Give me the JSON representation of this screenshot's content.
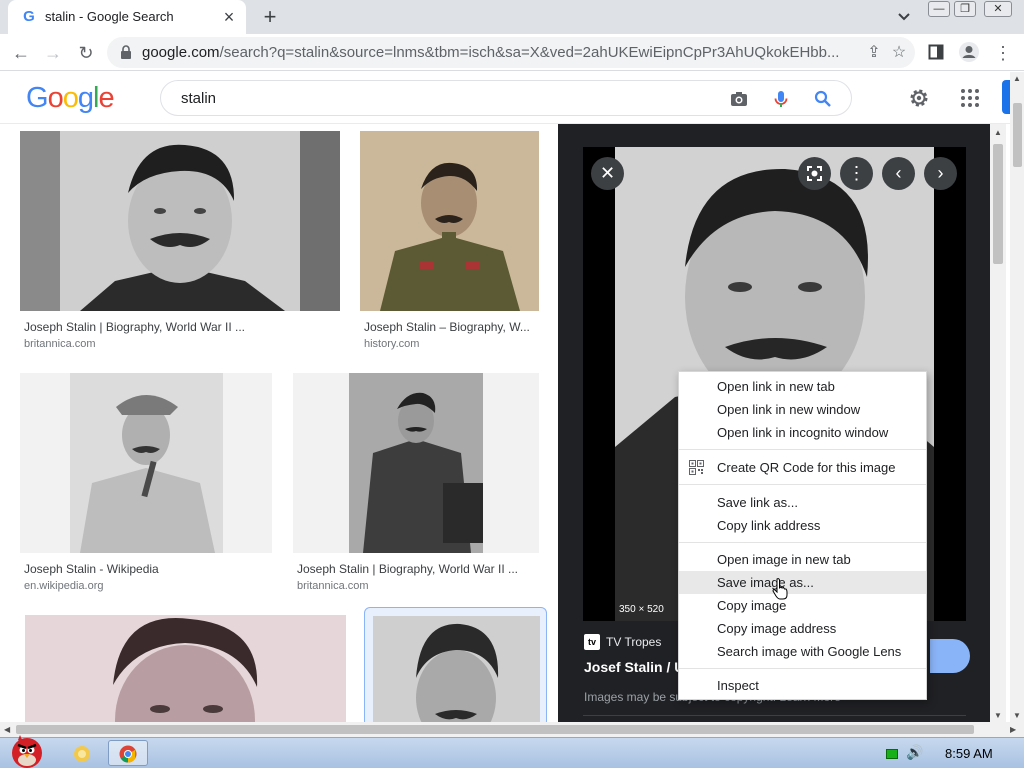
{
  "browser": {
    "tab_title": "stalin - Google Search",
    "favicon_letter": "G",
    "url_host": "google.com",
    "url_rest": "/search?q=stalin&source=lnms&tbm=isch&sa=X&ved=2ahUKEwiEipnCpPr3AhUQkokEHbb..."
  },
  "google": {
    "logo_letters": [
      "G",
      "o",
      "o",
      "g",
      "l",
      "e"
    ],
    "logo_colors": [
      "#4285f4",
      "#ea4335",
      "#fbbc05",
      "#4285f4",
      "#34a853",
      "#ea4335"
    ],
    "query": "stalin"
  },
  "results": [
    {
      "caption": "Joseph Stalin | Biography, World War II ...",
      "source": "britannica.com"
    },
    {
      "caption": "Joseph Stalin – Biography, W...",
      "source": "history.com"
    },
    {
      "caption": "Joseph Stalin - Wikipedia",
      "source": "en.wikipedia.org"
    },
    {
      "caption": "Joseph Stalin | Biography, World War II ...",
      "source": "britannica.com"
    }
  ],
  "preview": {
    "dimensions": "350 × 520",
    "source_logo": "tv",
    "source": "TV Tropes",
    "title": "Josef Stalin / U",
    "note": "Images may be subject to copyright. Learn More"
  },
  "context_menu": {
    "items": [
      "Open link in new tab",
      "Open link in new window",
      "Open link in incognito window",
      "Create QR Code for this image",
      "Save link as...",
      "Copy link address",
      "Open image in new tab",
      "Save image as...",
      "Copy image",
      "Copy image address",
      "Search image with Google Lens",
      "Inspect"
    ]
  },
  "taskbar": {
    "clock": "8:59 AM"
  },
  "colors": {
    "accent": "#1a73e8",
    "preview_bg": "#202124",
    "taskbar": "#b8cde8"
  }
}
